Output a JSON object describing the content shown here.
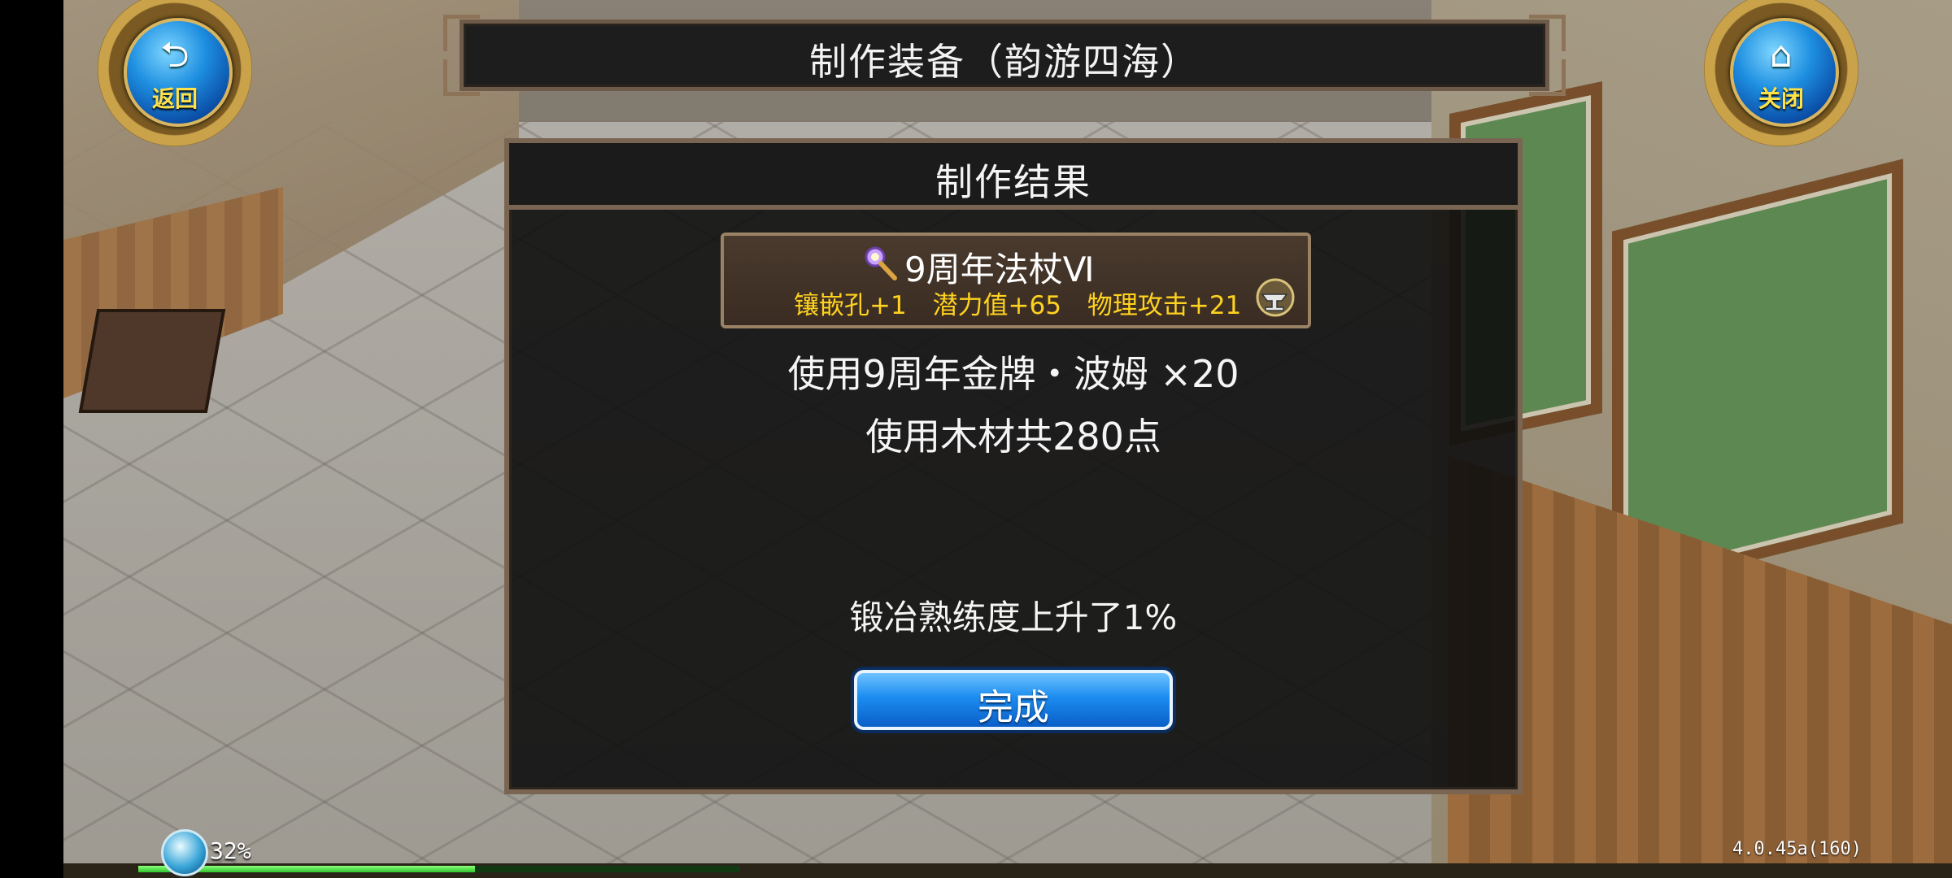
{
  "nav": {
    "back_label": "返回",
    "close_label": "关闭",
    "back_icon": "return-arrow-icon",
    "close_icon": "home-icon"
  },
  "title": "制作装备（韵游四海）",
  "result_panel": {
    "title": "制作结果",
    "item": {
      "icon": "staff-icon",
      "name": "9周年法杖Ⅵ",
      "stats": [
        "镶嵌孔+1",
        "潜力值+65",
        "物理攻击+21"
      ],
      "badge_icon": "anvil-icon"
    },
    "used_medal": "使用9周年金牌・波姆 ×20",
    "used_wood": "使用木材共280点",
    "skill_up": "锻冶熟练度上升了1%",
    "done_button": "完成"
  },
  "status": {
    "exp_percent_text": "32%",
    "exp_fraction": 0.56,
    "version": "4.0.45a(160)"
  },
  "colors": {
    "stat_yellow": "#ffd21f",
    "button_blue": "#1b8cf0",
    "nav_label": "#ffe14a"
  }
}
